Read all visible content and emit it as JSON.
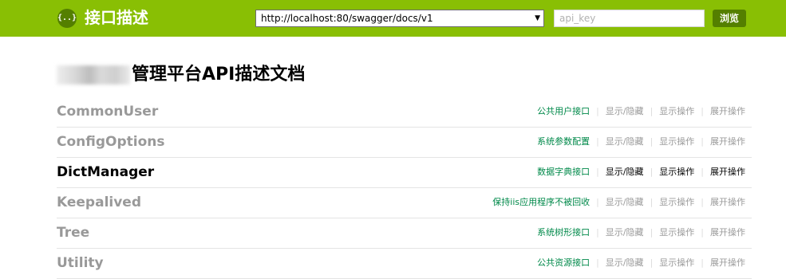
{
  "header": {
    "logo_glyph": "{..}",
    "title": "接口描述",
    "url_value": "http://localhost:80/swagger/docs/v1",
    "api_key_placeholder": "api_key",
    "explore_label": "浏览",
    "bar_color": "#89bf04",
    "button_color": "#547f00"
  },
  "main": {
    "title_suffix": "管理平台API描述文档"
  },
  "resources": [
    {
      "name": "CommonUser",
      "description": "公共用户接口",
      "show_hide": "显示/隐藏",
      "list_ops": "显示操作",
      "expand_ops": "展开操作"
    },
    {
      "name": "ConfigOptions",
      "description": "系统参数配置",
      "show_hide": "显示/隐藏",
      "list_ops": "显示操作",
      "expand_ops": "展开操作"
    },
    {
      "name": "DictManager",
      "description": "数据字典接口",
      "show_hide": "显示/隐藏",
      "list_ops": "显示操作",
      "expand_ops": "展开操作"
    },
    {
      "name": "Keepalived",
      "description": "保持iis应用程序不被回收",
      "show_hide": "显示/隐藏",
      "list_ops": "显示操作",
      "expand_ops": "展开操作"
    },
    {
      "name": "Tree",
      "description": "系统树形接口",
      "show_hide": "显示/隐藏",
      "list_ops": "显示操作",
      "expand_ops": "展开操作"
    },
    {
      "name": "Utility",
      "description": "公共资源接口",
      "show_hide": "显示/隐藏",
      "list_ops": "显示操作",
      "expand_ops": "展开操作"
    }
  ],
  "colors": {
    "description_text": "#00894a",
    "inactive_text": "#999999",
    "active_text": "#000000"
  }
}
